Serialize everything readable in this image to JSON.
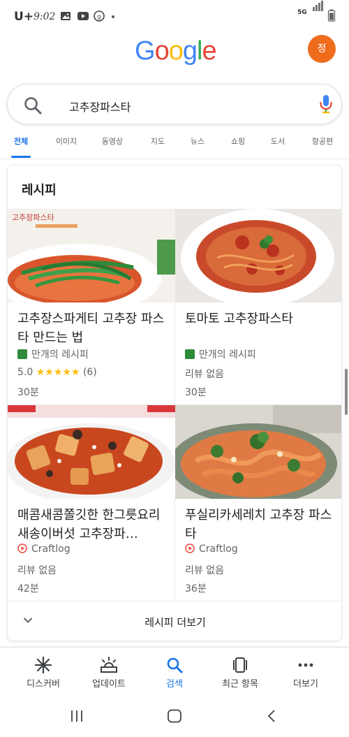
{
  "status_bar": {
    "carrier": "U+",
    "time": "9:02",
    "network": "5G"
  },
  "header": {
    "logo_letters": [
      "G",
      "o",
      "o",
      "g",
      "l",
      "e"
    ],
    "avatar_initial": "정"
  },
  "search": {
    "query": "고추장파스타"
  },
  "tabs": [
    {
      "label": "전체",
      "active": true
    },
    {
      "label": "이미지"
    },
    {
      "label": "동영상"
    },
    {
      "label": "지도"
    },
    {
      "label": "뉴스"
    },
    {
      "label": "쇼핑"
    },
    {
      "label": "도서"
    },
    {
      "label": "항공편"
    }
  ],
  "recipes_card": {
    "title": "레시피",
    "items": [
      {
        "title": "고추장스파게티 고추장 파스타 만드는 법",
        "source": "만개의 레시피",
        "rating_value": "5.0",
        "stars": "★★★★★",
        "rating_count": "(6)",
        "time": "30분"
      },
      {
        "title": "토마토 고추장파스타",
        "source": "만개의 레시피",
        "review": "리뷰 없음",
        "time": "30분"
      },
      {
        "title": "매콤새콤쫄깃한 한그릇요리 새송이버섯 고추장파…",
        "source": "Craftlog",
        "review": "리뷰 없음",
        "time": "42분"
      },
      {
        "title": "푸실리카세레치 고추장 파스타",
        "source": "Craftlog",
        "review": "리뷰 없음",
        "time": "36분"
      }
    ],
    "more_label": "레시피 더보기"
  },
  "bottom_nav": [
    {
      "label": "디스커버",
      "icon": "asterisk-icon"
    },
    {
      "label": "업데이트",
      "icon": "updates-icon"
    },
    {
      "label": "검색",
      "icon": "search-icon",
      "active": true
    },
    {
      "label": "최근 항목",
      "icon": "recent-icon"
    },
    {
      "label": "더보기",
      "icon": "more-dots-icon"
    }
  ],
  "colors": {
    "accent": "#1a73e8",
    "avatar": "#ef6c1d",
    "star": "#fbbc05",
    "manggae_favicon": "#2e8b3a",
    "craftlog_favicon": "#e5483b"
  }
}
